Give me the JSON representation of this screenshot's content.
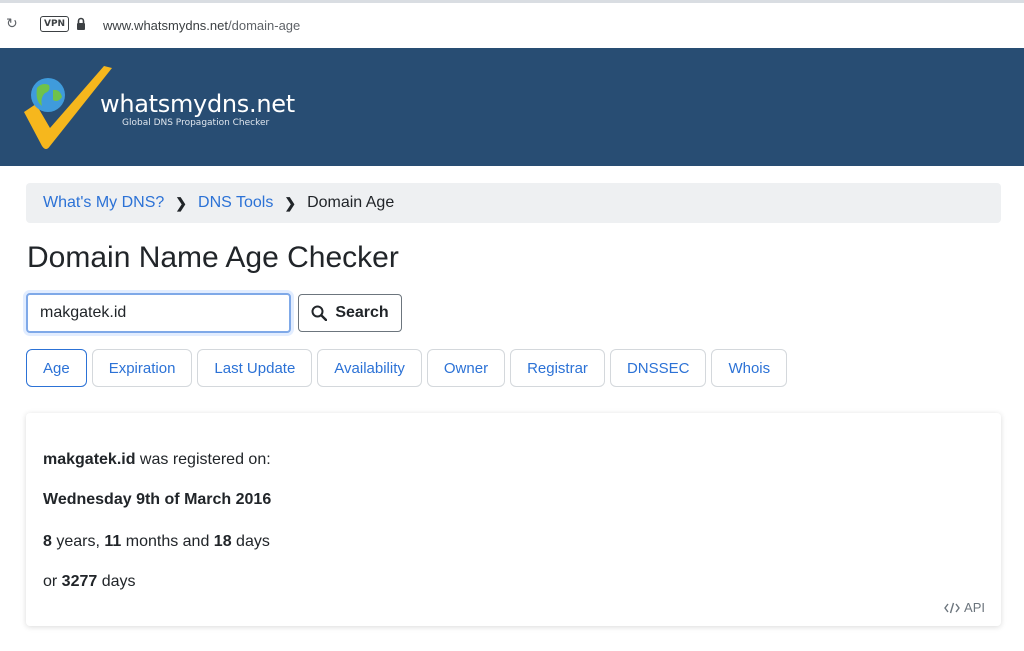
{
  "browser": {
    "reload_icon": "reload-icon",
    "vpn_label": "VPN",
    "url_host": "www.whatsmydns.net",
    "url_path": "/domain-age"
  },
  "site": {
    "name": "whatsmydns.net",
    "tagline": "Global DNS Propagation Checker",
    "header_color": "#284d73",
    "link_color": "#2c72d6"
  },
  "breadcrumb": {
    "items": [
      "What's My DNS?",
      "DNS Tools"
    ],
    "current": "Domain Age"
  },
  "page": {
    "title": "Domain Name Age Checker"
  },
  "search": {
    "value": "makgatek.id",
    "button_label": "Search"
  },
  "tabs": [
    {
      "label": "Age",
      "active": true
    },
    {
      "label": "Expiration"
    },
    {
      "label": "Last Update"
    },
    {
      "label": "Availability"
    },
    {
      "label": "Owner"
    },
    {
      "label": "Registrar"
    },
    {
      "label": "DNSSEC"
    },
    {
      "label": "Whois"
    }
  ],
  "result": {
    "domain": "makgatek.id",
    "registered_text": " was registered on:",
    "date": "Wednesday 9th of March 2016",
    "years": "8",
    "years_word": " years, ",
    "months": "11",
    "months_word": " months and ",
    "days": "18",
    "days_word": " days",
    "or_word": "or ",
    "total_days": "3277",
    "total_days_word": " days"
  },
  "api": {
    "label": "API"
  }
}
